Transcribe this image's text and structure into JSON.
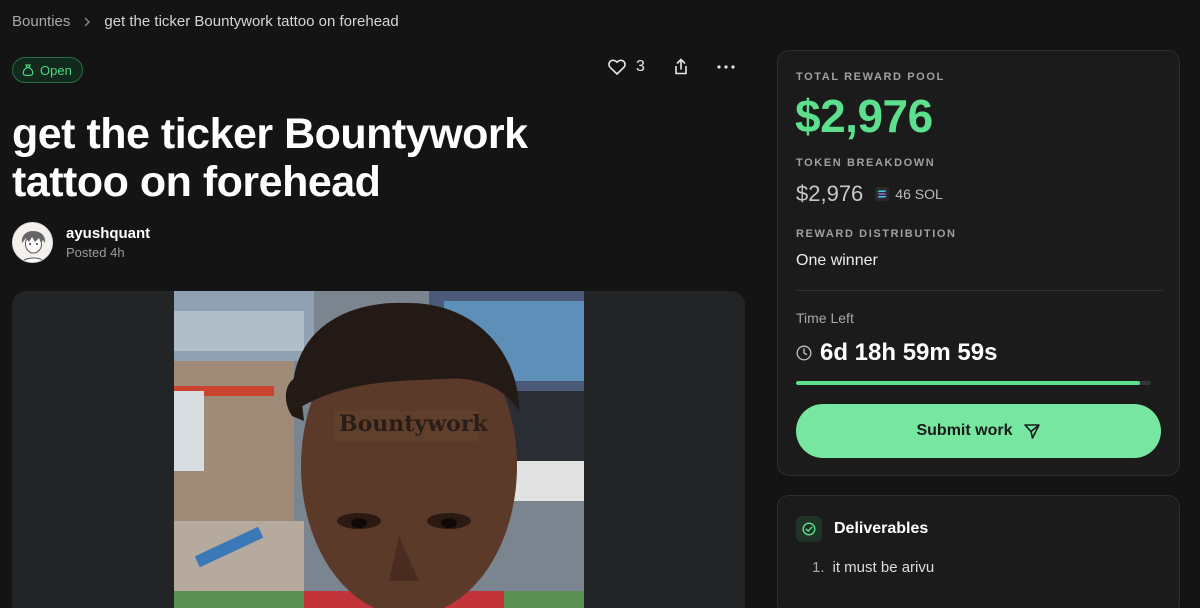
{
  "breadcrumb": {
    "parent": "Bounties",
    "current": "get the ticker Bountywork tattoo on forehead"
  },
  "status": {
    "label": "Open",
    "color": "#4fd67f",
    "icon": "money-bag-icon"
  },
  "actions": {
    "like_count": "3",
    "share_icon": "share-icon",
    "more_icon": "more-icon"
  },
  "bounty": {
    "title": "get the ticker Bountywork tattoo on forehead",
    "author": "ayushquant",
    "posted": "Posted 4h",
    "image_text": "Bountywork"
  },
  "reward": {
    "pool_label": "TOTAL REWARD POOL",
    "pool_amount": "$2,976",
    "breakdown_label": "TOKEN BREAKDOWN",
    "breakdown_usd": "$2,976",
    "breakdown_token": "46 SOL",
    "distribution_label": "REWARD DISTRIBUTION",
    "distribution_value": "One winner",
    "time_label": "Time Left",
    "time_value": "6d 18h 59m 59s",
    "time_remaining_fraction": 0.97,
    "submit_label": "Submit work",
    "accent_color": "#5ce08e"
  },
  "deliverables": {
    "title": "Deliverables",
    "items": [
      {
        "num": "1.",
        "text": "it must be arivu"
      }
    ]
  }
}
